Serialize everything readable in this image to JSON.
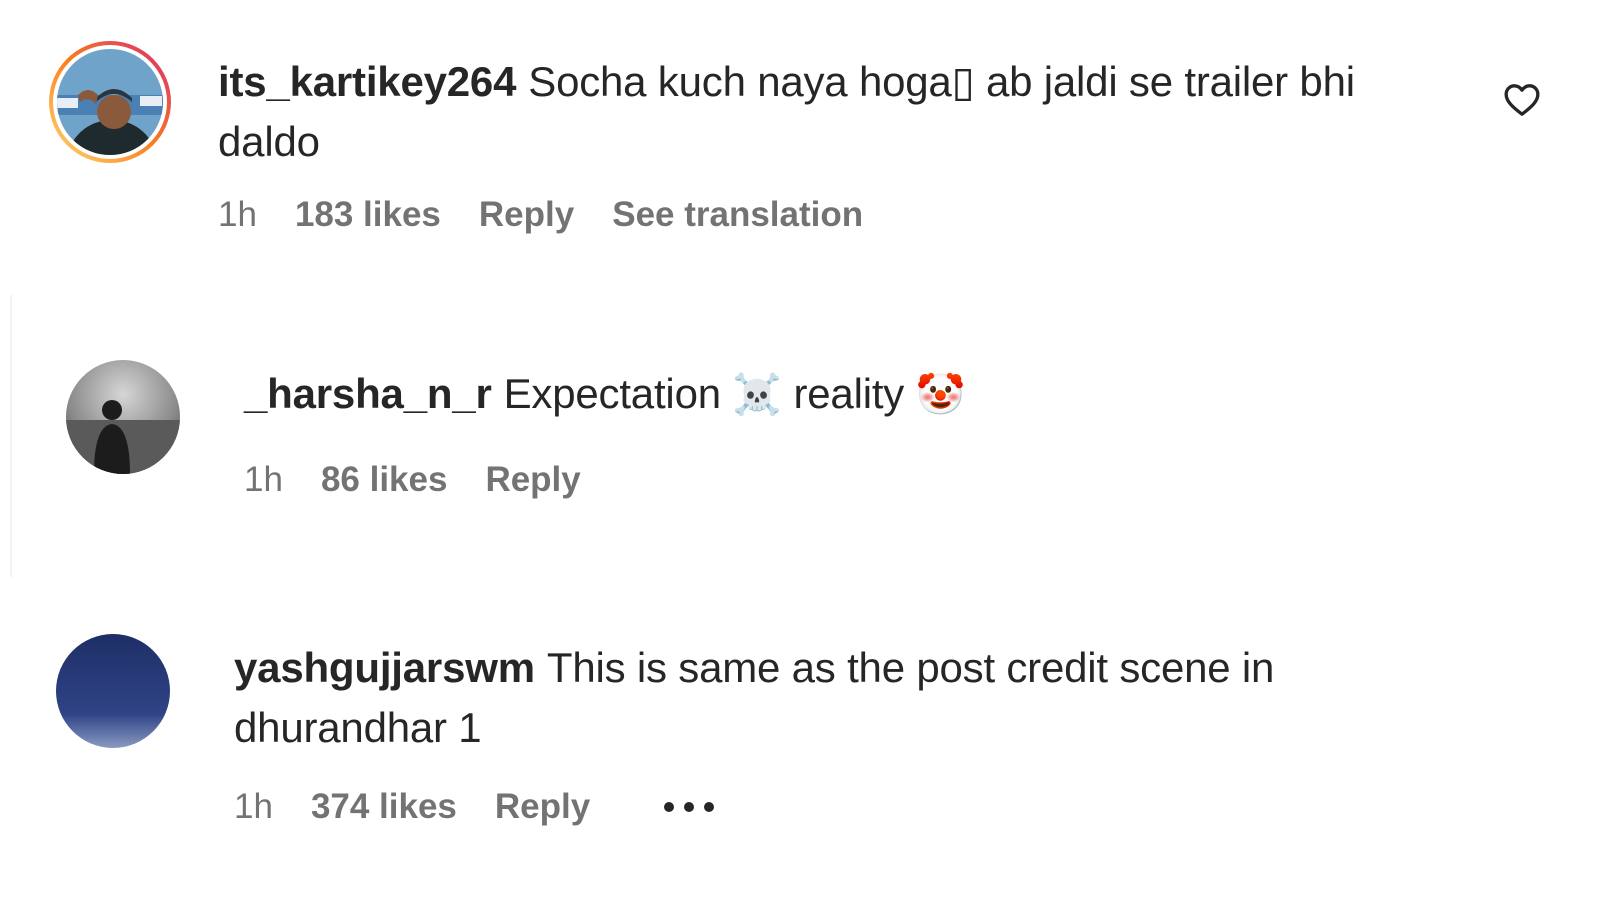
{
  "comments": [
    {
      "username": "its_kartikey264",
      "text": "Socha kuch naya hoga▯ ab jaldi se trailer bhi daldo",
      "time": "1h",
      "likes": "183 likes",
      "reply": "Reply",
      "translation": "See translation"
    },
    {
      "username": "_harsha_n_r",
      "text_before": "Expectation",
      "emoji1": "☠️",
      "text_middle": "reality",
      "emoji2": "🤡",
      "time": "1h",
      "likes": "86 likes",
      "reply": "Reply"
    },
    {
      "username": "yashgujjarswm",
      "text": "This is same as the post credit scene in dhurandhar 1",
      "time": "1h",
      "likes": "374 likes",
      "reply": "Reply"
    }
  ],
  "icons": {
    "like": "heart-outline-icon",
    "more": "more-horizontal-icon"
  },
  "colors": {
    "text": "#262626",
    "secondary": "#737373",
    "story_ring_start": "#feda75",
    "story_ring_end": "#d62976"
  }
}
